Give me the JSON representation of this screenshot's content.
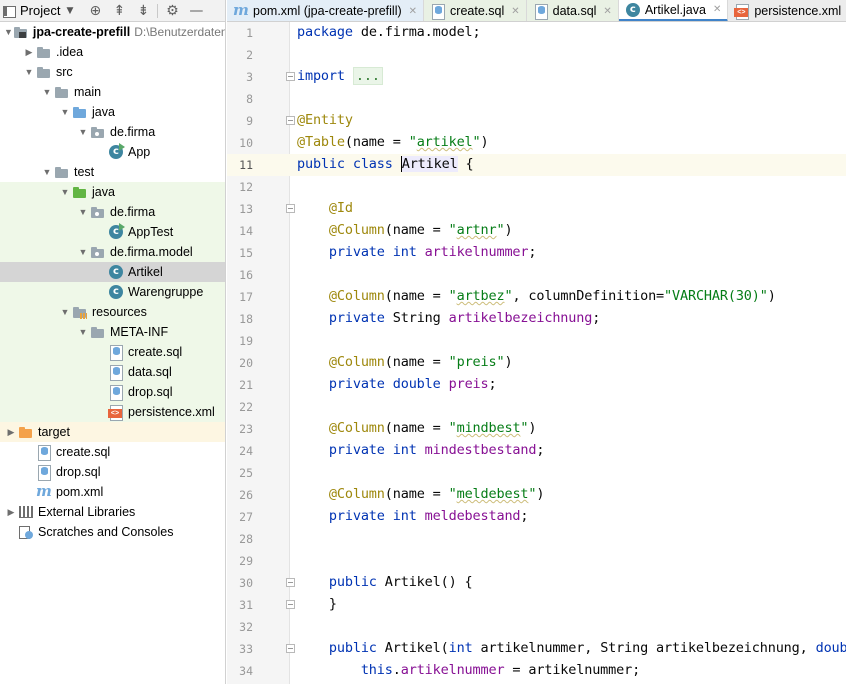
{
  "project_panel": {
    "title": "Project",
    "tree": [
      {
        "label": "jpa-create-prefill",
        "path": "D:\\Benutzerdaten\\",
        "indent": 0,
        "arrow": "down",
        "icon": "project-folder-icon",
        "bold": true
      },
      {
        "label": ".idea",
        "indent": 1,
        "arrow": "right",
        "icon": "folder-icon"
      },
      {
        "label": "src",
        "indent": 1,
        "arrow": "down",
        "icon": "folder-icon"
      },
      {
        "label": "main",
        "indent": 2,
        "arrow": "down",
        "icon": "folder-icon"
      },
      {
        "label": "java",
        "indent": 3,
        "arrow": "down",
        "icon": "source-folder-icon"
      },
      {
        "label": "de.firma",
        "indent": 4,
        "arrow": "down",
        "icon": "package-icon"
      },
      {
        "label": "App",
        "indent": 5,
        "arrow": "none",
        "icon": "class-run-icon"
      },
      {
        "label": "test",
        "indent": 2,
        "arrow": "down",
        "icon": "folder-icon"
      },
      {
        "label": "java",
        "indent": 3,
        "arrow": "down",
        "icon": "test-folder-icon",
        "bg": "test"
      },
      {
        "label": "de.firma",
        "indent": 4,
        "arrow": "down",
        "icon": "package-icon",
        "bg": "test"
      },
      {
        "label": "AppTest",
        "indent": 5,
        "arrow": "none",
        "icon": "class-run-icon",
        "bg": "test"
      },
      {
        "label": "de.firma.model",
        "indent": 4,
        "arrow": "down",
        "icon": "package-icon",
        "bg": "test"
      },
      {
        "label": "Artikel",
        "indent": 5,
        "arrow": "none",
        "icon": "class-icon",
        "bg": "selected"
      },
      {
        "label": "Warengruppe",
        "indent": 5,
        "arrow": "none",
        "icon": "class-icon",
        "bg": "test"
      },
      {
        "label": "resources",
        "indent": 3,
        "arrow": "down",
        "icon": "resources-folder-icon",
        "bg": "test"
      },
      {
        "label": "META-INF",
        "indent": 4,
        "arrow": "down",
        "icon": "folder-icon",
        "bg": "test"
      },
      {
        "label": "create.sql",
        "indent": 5,
        "arrow": "none",
        "icon": "sql-file-icon",
        "bg": "test"
      },
      {
        "label": "data.sql",
        "indent": 5,
        "arrow": "none",
        "icon": "sql-file-icon",
        "bg": "test"
      },
      {
        "label": "drop.sql",
        "indent": 5,
        "arrow": "none",
        "icon": "sql-file-icon",
        "bg": "test"
      },
      {
        "label": "persistence.xml",
        "indent": 5,
        "arrow": "none",
        "icon": "xml-file-icon",
        "bg": "test"
      },
      {
        "label": "target",
        "indent": 0,
        "arrow": "right",
        "icon": "excluded-folder-icon",
        "bg": "target"
      },
      {
        "label": "create.sql",
        "indent": 1,
        "arrow": "none",
        "icon": "sql-file-icon"
      },
      {
        "label": "drop.sql",
        "indent": 1,
        "arrow": "none",
        "icon": "sql-file-icon"
      },
      {
        "label": "pom.xml",
        "indent": 1,
        "arrow": "none",
        "icon": "maven-icon"
      },
      {
        "label": "External Libraries",
        "indent": 0,
        "arrow": "right",
        "icon": "libraries-icon"
      },
      {
        "label": "Scratches and Consoles",
        "indent": 0,
        "arrow": "none",
        "icon": "scratches-icon"
      }
    ]
  },
  "tabs": [
    {
      "label": "pom.xml (jpa-create-prefill)",
      "icon": "maven-icon",
      "kind": "maven"
    },
    {
      "label": "create.sql",
      "icon": "sql-file-icon",
      "kind": "sql"
    },
    {
      "label": "data.sql",
      "icon": "sql-file-icon",
      "kind": "sql"
    },
    {
      "label": "Artikel.java",
      "icon": "class-icon",
      "kind": "active"
    },
    {
      "label": "persistence.xml",
      "icon": "xml-file-icon",
      "kind": "xml"
    }
  ],
  "editor": {
    "current_line": "11",
    "lines": [
      {
        "n": "1",
        "html": "<span class=\"kw\">package</span> de.firma.model;"
      },
      {
        "n": "2",
        "html": ""
      },
      {
        "n": "3",
        "html": "<span class=\"kw\">import</span> <span class=\"folded\">...</span>",
        "fold": true
      },
      {
        "n": "8",
        "html": ""
      },
      {
        "n": "9",
        "html": "<span class=\"ann\">@Entity</span>",
        "fold": true
      },
      {
        "n": "10",
        "html": "<span class=\"ann\">@Table</span>(name = <span class=\"str\">\"<span class=\"underline\">artikel</span>\"</span>)"
      },
      {
        "n": "11",
        "html": "<span class=\"kw\">public class</span> <span class=\"caret-cls\"><span class=\"caret\"></span>Artikel</span> {"
      },
      {
        "n": "12",
        "html": ""
      },
      {
        "n": "13",
        "html": "    <span class=\"ann\">@Id</span>",
        "fold": true
      },
      {
        "n": "14",
        "html": "    <span class=\"ann\">@Column</span>(name = <span class=\"str\">\"<span class=\"underline\">artnr</span>\"</span>)"
      },
      {
        "n": "15",
        "html": "    <span class=\"kw\">private int</span> <span class=\"fld\">artikelnummer</span>;"
      },
      {
        "n": "16",
        "html": ""
      },
      {
        "n": "17",
        "html": "    <span class=\"ann\">@Column</span>(name = <span class=\"str\">\"<span class=\"underline\">artbez</span>\"</span>, columnDefinition=<span class=\"str\">\"VARCHAR(30)\"</span>)"
      },
      {
        "n": "18",
        "html": "    <span class=\"kw\">private</span> String <span class=\"fld\">artikelbezeichnung</span>;"
      },
      {
        "n": "19",
        "html": ""
      },
      {
        "n": "20",
        "html": "    <span class=\"ann\">@Column</span>(name = <span class=\"str\">\"preis\"</span>)"
      },
      {
        "n": "21",
        "html": "    <span class=\"kw\">private double</span> <span class=\"fld\">preis</span>;"
      },
      {
        "n": "22",
        "html": ""
      },
      {
        "n": "23",
        "html": "    <span class=\"ann\">@Column</span>(name = <span class=\"str\">\"<span class=\"underline\">mindbest</span>\"</span>)"
      },
      {
        "n": "24",
        "html": "    <span class=\"kw\">private int</span> <span class=\"fld\">mindestbestand</span>;"
      },
      {
        "n": "25",
        "html": ""
      },
      {
        "n": "26",
        "html": "    <span class=\"ann\">@Column</span>(name = <span class=\"str\">\"<span class=\"underline\">meldebest</span>\"</span>)"
      },
      {
        "n": "27",
        "html": "    <span class=\"kw\">private int</span> <span class=\"fld\">meldebestand</span>;"
      },
      {
        "n": "28",
        "html": ""
      },
      {
        "n": "29",
        "html": ""
      },
      {
        "n": "30",
        "html": "    <span class=\"kw\">public</span> Artikel() {",
        "fold": true
      },
      {
        "n": "31",
        "html": "    }",
        "fold": true
      },
      {
        "n": "32",
        "html": ""
      },
      {
        "n": "33",
        "html": "    <span class=\"kw\">public</span> Artikel(<span class=\"kw\">int</span> artikelnummer, String artikelbezeichnung, <span class=\"kw\">double</span> preis,",
        "fold": true
      },
      {
        "n": "34",
        "html": "        <span class=\"kw\">this</span>.<span class=\"fld\">artikelnummer</span> = artikelnummer;"
      }
    ]
  },
  "icons": {
    "header": [
      "locate-icon",
      "collapse-all-icon",
      "expand-all-icon",
      "gear-icon",
      "minimize-icon"
    ]
  }
}
